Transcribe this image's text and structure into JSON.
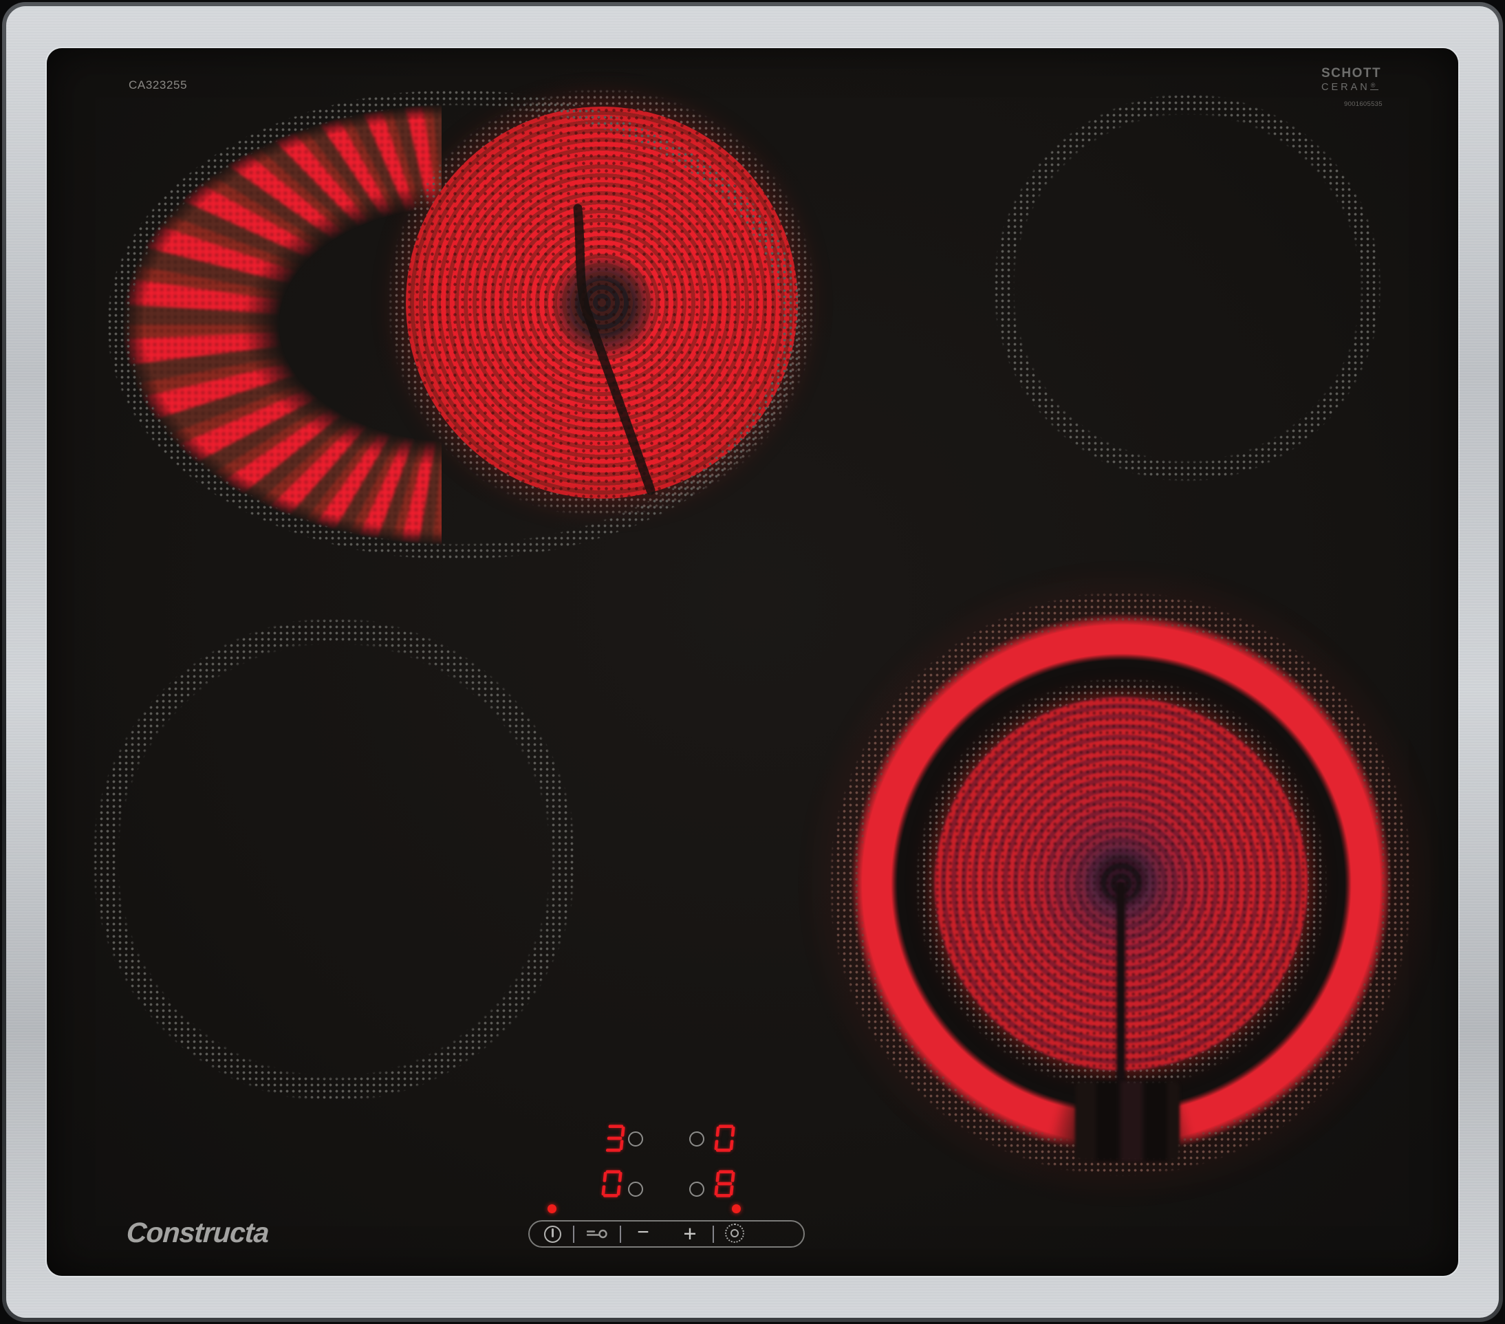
{
  "glass": {
    "model_code": "CA323255",
    "schott_logo": {
      "line1": "SCHOTT",
      "line2": "CERAN",
      "registered": "®",
      "serial": "9001605535"
    },
    "brand_logo": "Constructa"
  },
  "display": {
    "rear_left_level": "3",
    "rear_right_level": "0",
    "front_left_level": "0",
    "front_right_level": "8"
  },
  "controls": {
    "minus_label": "−",
    "plus_label": "+",
    "icons": [
      "power-icon",
      "child-lock-key-icon",
      "minus",
      "plus",
      "dual-zone-icon"
    ]
  },
  "colors": {
    "heat_red": "#e2232b",
    "digit_red": "#ee1b22",
    "indicator_red": "#ef1d1a",
    "halftone_dot_gray": "#5c5b57",
    "steel": "#c6cacf",
    "glass_black": "#151311"
  }
}
